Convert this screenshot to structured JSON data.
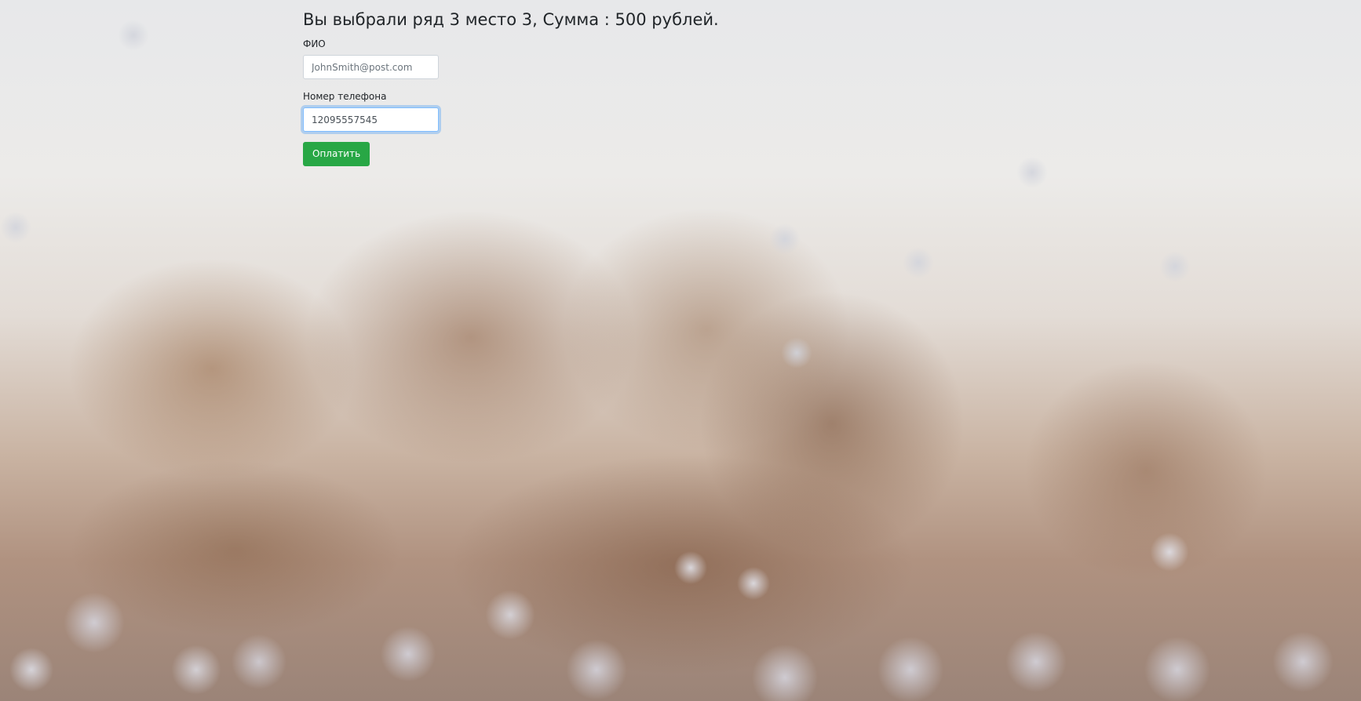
{
  "page": {
    "title": "Вы выбрали ряд 3 место 3, Сумма : 500 рублей."
  },
  "form": {
    "fio": {
      "label": "ФИО",
      "placeholder": "JohnSmith@post.com",
      "value": ""
    },
    "phone": {
      "label": "Номер телефона",
      "placeholder": "",
      "value": "12095557545"
    },
    "submit_label": "Оплатить"
  },
  "colors": {
    "button_bg": "#28a745",
    "focus_border": "#80bdff"
  }
}
